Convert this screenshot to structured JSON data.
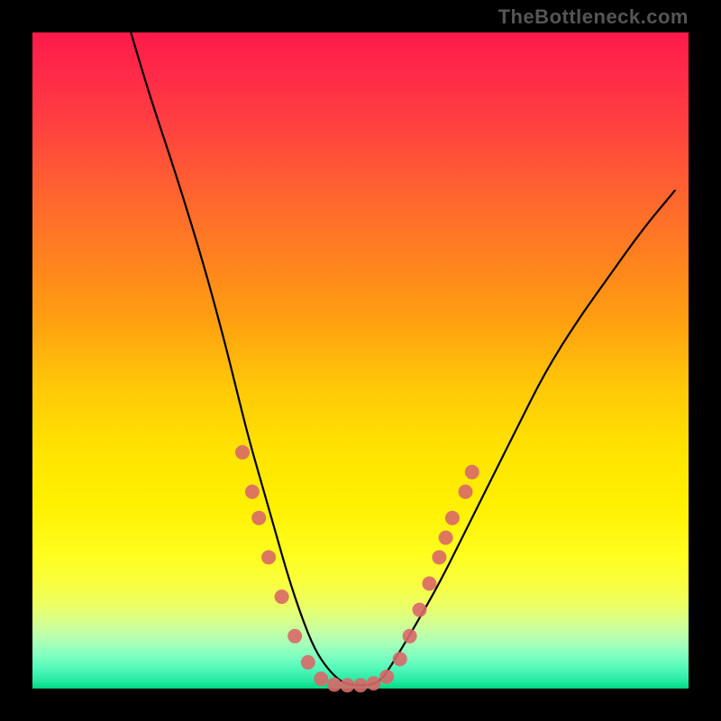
{
  "watermark": "TheBottleneck.com",
  "chart_data": {
    "type": "line",
    "title": "",
    "xlabel": "",
    "ylabel": "",
    "xlim": [
      0,
      100
    ],
    "ylim": [
      0,
      100
    ],
    "series": [
      {
        "name": "curve",
        "x": [
          15,
          18,
          22,
          26,
          29,
          31,
          33,
          35,
          37,
          39,
          41,
          43,
          45,
          47,
          49,
          51,
          53,
          55,
          58,
          62,
          66,
          70,
          74,
          78,
          83,
          88,
          93,
          98
        ],
        "values": [
          100,
          90,
          78,
          65,
          54,
          46,
          38,
          31,
          24,
          17,
          11,
          6,
          3,
          1,
          0.5,
          0.5,
          1,
          4,
          9,
          16,
          24,
          32,
          40,
          48,
          56,
          63,
          70,
          76
        ]
      }
    ],
    "markers": [
      {
        "x": 32,
        "y": 36
      },
      {
        "x": 33.5,
        "y": 30
      },
      {
        "x": 34.5,
        "y": 26
      },
      {
        "x": 36,
        "y": 20
      },
      {
        "x": 38,
        "y": 14
      },
      {
        "x": 40,
        "y": 8
      },
      {
        "x": 42,
        "y": 4
      },
      {
        "x": 44,
        "y": 1.5
      },
      {
        "x": 46,
        "y": 0.6
      },
      {
        "x": 48,
        "y": 0.5
      },
      {
        "x": 50,
        "y": 0.5
      },
      {
        "x": 52,
        "y": 0.8
      },
      {
        "x": 54,
        "y": 1.8
      },
      {
        "x": 56,
        "y": 4.5
      },
      {
        "x": 57.5,
        "y": 8
      },
      {
        "x": 59,
        "y": 12
      },
      {
        "x": 60.5,
        "y": 16
      },
      {
        "x": 62,
        "y": 20
      },
      {
        "x": 63,
        "y": 23
      },
      {
        "x": 64,
        "y": 26
      },
      {
        "x": 66,
        "y": 30
      },
      {
        "x": 67,
        "y": 33
      }
    ],
    "marker_color": "#d96868",
    "curve_color": "#000000",
    "marker_radius": 8
  }
}
